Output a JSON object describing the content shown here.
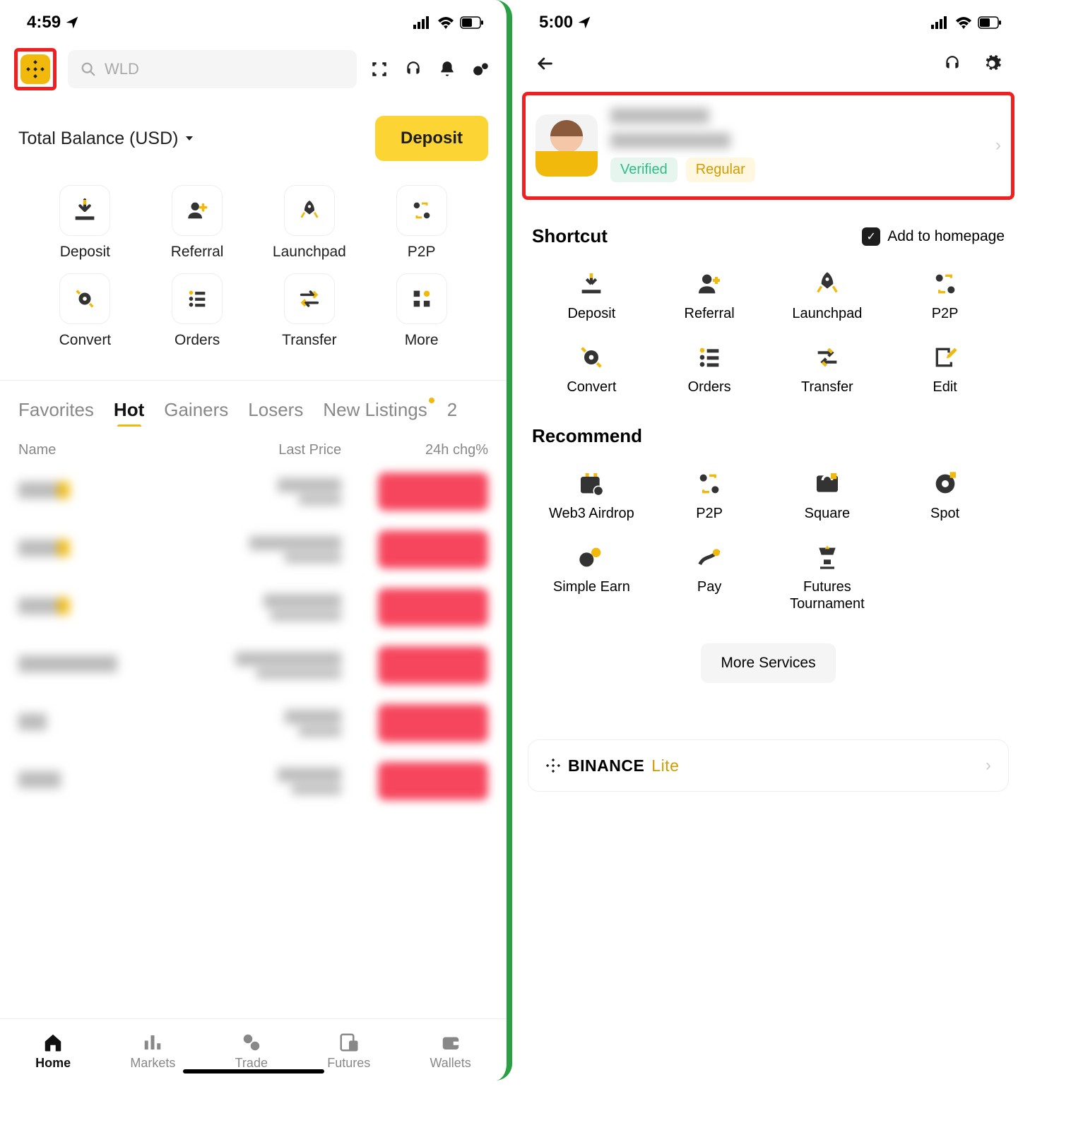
{
  "left": {
    "status_time": "4:59",
    "search_placeholder": "WLD",
    "balance_label": "Total Balance (USD)",
    "deposit_btn": "Deposit",
    "shortcuts": [
      {
        "label": "Deposit"
      },
      {
        "label": "Referral"
      },
      {
        "label": "Launchpad"
      },
      {
        "label": "P2P"
      },
      {
        "label": "Convert"
      },
      {
        "label": "Orders"
      },
      {
        "label": "Transfer"
      },
      {
        "label": "More"
      }
    ],
    "tabs": [
      "Favorites",
      "Hot",
      "Gainers",
      "Losers",
      "New Listings",
      "2"
    ],
    "tab_active_index": 1,
    "list_headers": {
      "name": "Name",
      "price": "Last Price",
      "chg": "24h chg%"
    },
    "nav": [
      {
        "label": "Home"
      },
      {
        "label": "Markets"
      },
      {
        "label": "Trade"
      },
      {
        "label": "Futures"
      },
      {
        "label": "Wallets"
      }
    ],
    "nav_active_index": 0
  },
  "right": {
    "status_time": "5:00",
    "badge_verified": "Verified",
    "badge_regular": "Regular",
    "section_shortcut": "Shortcut",
    "add_homepage": "Add to homepage",
    "shortcuts": [
      {
        "label": "Deposit"
      },
      {
        "label": "Referral"
      },
      {
        "label": "Launchpad"
      },
      {
        "label": "P2P"
      },
      {
        "label": "Convert"
      },
      {
        "label": "Orders"
      },
      {
        "label": "Transfer"
      },
      {
        "label": "Edit"
      }
    ],
    "section_recommend": "Recommend",
    "recommend": [
      {
        "label": "Web3 Airdrop"
      },
      {
        "label": "P2P"
      },
      {
        "label": "Square"
      },
      {
        "label": "Spot"
      },
      {
        "label": "Simple Earn"
      },
      {
        "label": "Pay"
      },
      {
        "label": "Futures Tournament"
      }
    ],
    "more_services": "More Services",
    "lite_brand": "BINANCE",
    "lite_suffix": "Lite"
  }
}
